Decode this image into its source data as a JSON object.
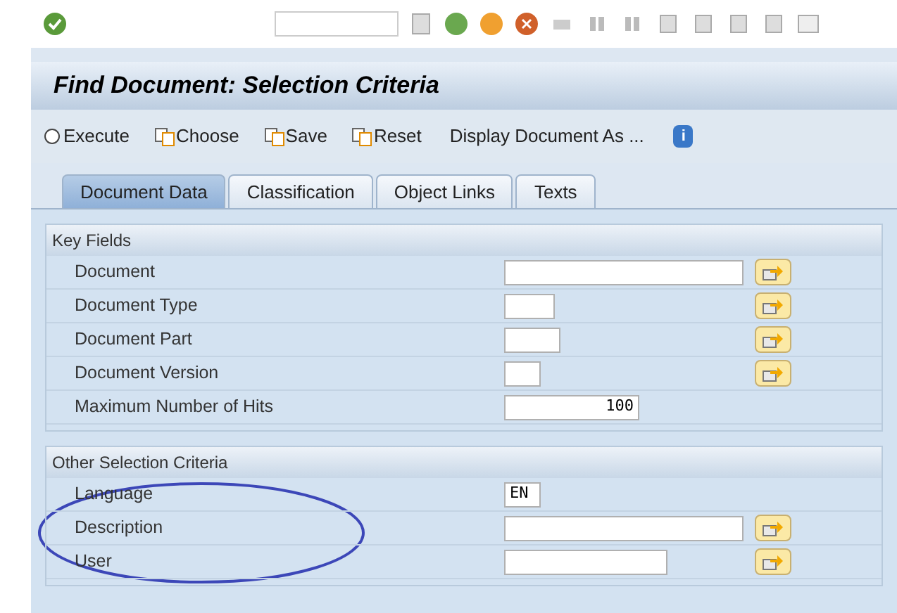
{
  "window": {
    "title": "Find Document: Selection Criteria"
  },
  "toolbar": [
    {
      "label": "Execute",
      "kind": "execute"
    },
    {
      "label": "Choose",
      "kind": "icon"
    },
    {
      "label": "Save",
      "kind": "icon"
    },
    {
      "label": "Reset",
      "kind": "icon"
    },
    {
      "label": "Display Document As ...",
      "kind": "plain"
    },
    {
      "label": "i",
      "kind": "info"
    }
  ],
  "tabs": [
    {
      "label": "Document Data",
      "selected": true
    },
    {
      "label": "Classification",
      "selected": false
    },
    {
      "label": "Object Links",
      "selected": false
    },
    {
      "label": "Texts",
      "selected": false
    }
  ],
  "groups": [
    {
      "title": "Key Fields",
      "fields": [
        {
          "label": "Document",
          "multi_select": true
        },
        {
          "label": "Document Type",
          "multi_select": true
        },
        {
          "label": "Document Part",
          "multi_select": true
        },
        {
          "label": "Document Version",
          "multi_select": true
        },
        {
          "label": "Maximum Number of Hits",
          "value": "100",
          "multi_select": false
        }
      ]
    },
    {
      "title": "Other Selection Criteria",
      "fields": [
        {
          "label": "Language",
          "value": "EN",
          "multi_select": false
        },
        {
          "label": "Description",
          "multi_select": true
        },
        {
          "label": "User",
          "multi_select": true
        }
      ]
    }
  ]
}
